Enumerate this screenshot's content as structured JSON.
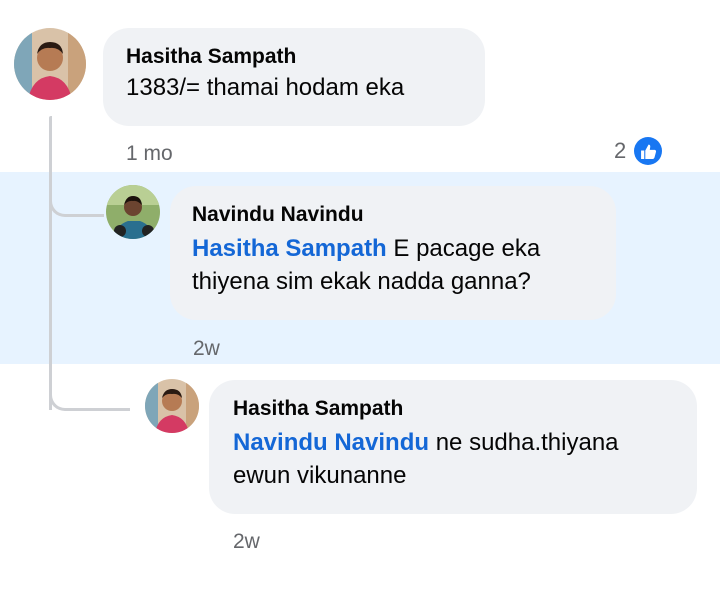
{
  "comment_1": {
    "author": "Hasitha Sampath",
    "text": "1383/= thamai hodam eka",
    "time": "1 mo",
    "reaction_count": "2",
    "reaction_icon": "like-icon"
  },
  "reply_1": {
    "author": "Navindu Navindu",
    "mention": "Hasitha Sampath",
    "text_line1": " E pacage eka",
    "text_line2": "thiyena sim ekak nadda ganna?",
    "time": "2w"
  },
  "reply_2": {
    "author": "Hasitha Sampath",
    "mention": "Navindu Navindu",
    "text_line1": " ne sudha.thiyana",
    "text_line2": "ewun vikunanne",
    "time": "2w"
  },
  "colors": {
    "mention": "#1467d6",
    "highlight": "#e7f3ff",
    "bubble": "#f0f2f5",
    "like": "#1877f2"
  }
}
